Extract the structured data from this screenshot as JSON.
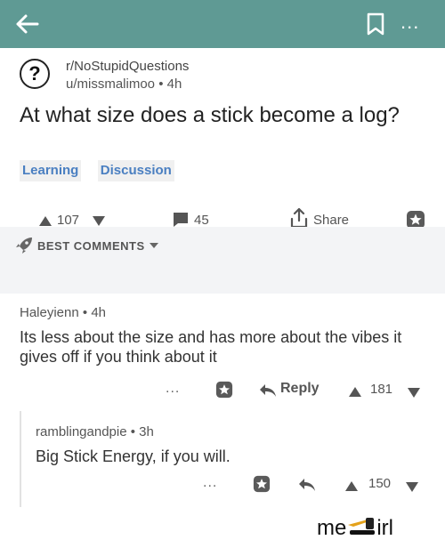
{
  "header": {
    "back_icon": "arrow-left-icon",
    "bookmark_icon": "bookmark-icon",
    "more_label": "...",
    "bar_color": "#5f9a94"
  },
  "post": {
    "subreddit": "r/NoStupidQuestions",
    "author": "u/missmalimoo",
    "age": "4h",
    "title": "At what size does a stick become a log?",
    "flairs": [
      "Learning",
      "Discussion"
    ],
    "score": "107",
    "comments": "45",
    "share_label": "Share"
  },
  "sort": {
    "label": "BEST COMMENTS"
  },
  "comments": [
    {
      "author": "Haleyienn",
      "age": "4h",
      "body": "Its less about the size and has more about the vibes it gives off if you think about it",
      "dots": "...",
      "reply_label": "Reply",
      "score": "181"
    },
    {
      "author": "ramblingandpie",
      "age": "3h",
      "body": "Big Stick Energy, if you will.",
      "dots": "...",
      "score": "150"
    }
  ],
  "caption": {
    "text_before": "me",
    "text_after": "irl"
  },
  "colors": {
    "flair_text": "#4a7fc1",
    "flair_bg": "#f0f0f0",
    "sort_bar_bg": "#f3f4f6"
  }
}
